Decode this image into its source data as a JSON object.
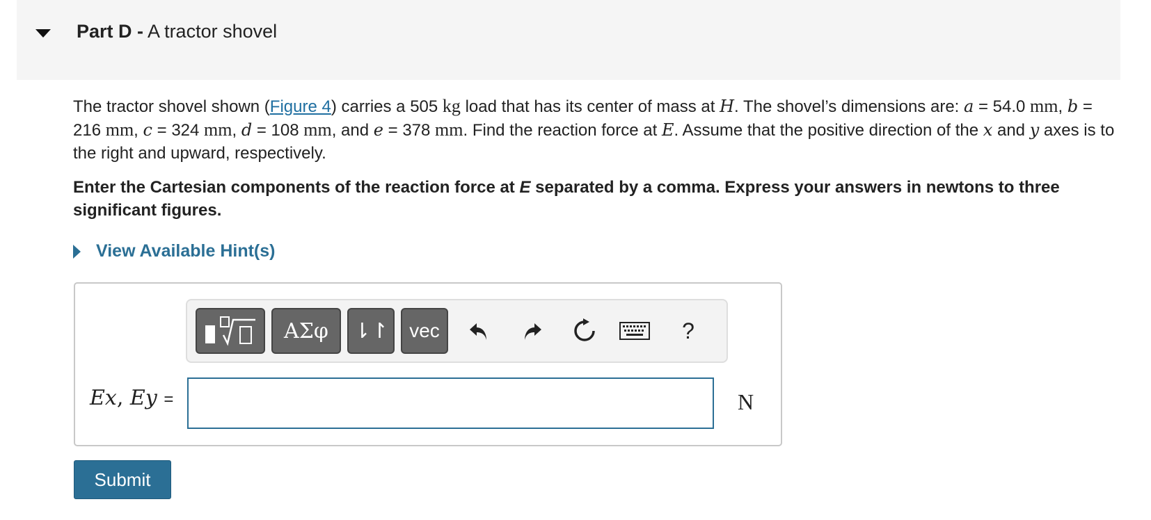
{
  "part": {
    "label": "Part D -",
    "title": "A tractor shovel"
  },
  "problem": {
    "t1": "The tractor shovel shown (",
    "figure_link": "Figure 4",
    "t2": ") carries a 505 ",
    "u_kg": "kg",
    "t3": " load that has its center of mass at ",
    "v_H": "H",
    "t4": ". The shovel’s dimensions are: ",
    "v_a": "a",
    "t5": " = 54.0 ",
    "u_mm1": "mm",
    "t6": ", ",
    "v_b": "b",
    "t7": " = 216 ",
    "u_mm2": "mm",
    "t8": ", ",
    "v_c": "c",
    "t9": " = 324 ",
    "u_mm3": "mm",
    "t10": ", ",
    "v_d": "d",
    "t11": " = 108 ",
    "u_mm4": "mm",
    "t12": ", and ",
    "v_e": "e",
    "t13": " = 378 ",
    "u_mm5": "mm",
    "t14": ". Find the reaction force at ",
    "v_E": "E",
    "t15": ". Assume that the positive direction of the ",
    "v_x": "x",
    "t16": " and ",
    "v_y": "y",
    "t17": " axes is to the right and upward, respectively."
  },
  "instruction": {
    "t1": "Enter the Cartesian components of the reaction force at ",
    "v_E": "E",
    "t2": " separated by a comma. Express your answers  in newtons to three significant figures."
  },
  "hint": {
    "label": "View Available Hint(s)"
  },
  "toolbar": {
    "greek_label": "ΑΣφ",
    "updown_label": "⇂↾",
    "vec_label": "vec",
    "help_label": "?"
  },
  "answer": {
    "var_Ex": "Ex",
    "var_Ey": "Ey",
    "sep": ",",
    "eq": "=",
    "value": "",
    "unit": "N"
  },
  "submit": {
    "label": "Submit"
  },
  "colors": {
    "accent": "#2b6f95",
    "link": "#1f6fa1",
    "toolbar_button": "#666666",
    "header_bg": "#f5f5f5"
  }
}
